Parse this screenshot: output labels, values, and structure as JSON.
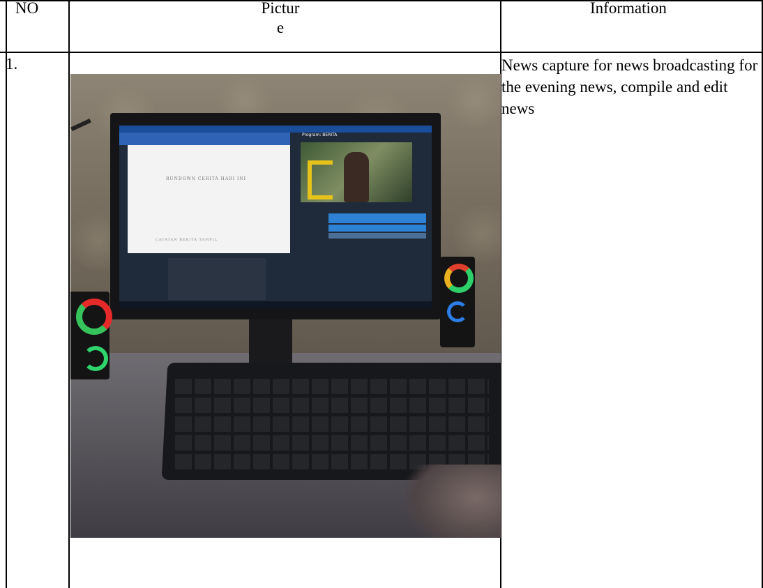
{
  "table": {
    "headers": {
      "no": "NO",
      "picture_line1": "Pictur",
      "picture_line2": "e",
      "information": "Information"
    },
    "rows": [
      {
        "no": "1.",
        "picture_alt": "Photo of a news editing computer setup with monitor, keyboard and speakers",
        "information": "News capture for news broadcasting for the evening news, compile and edit news"
      }
    ]
  },
  "photo_screen": {
    "document_heading": "RUNDOWN CERITA HARI INI",
    "document_footer": "CATATAN BERITA TAMPIL",
    "program_label": "Program: BERITA"
  }
}
